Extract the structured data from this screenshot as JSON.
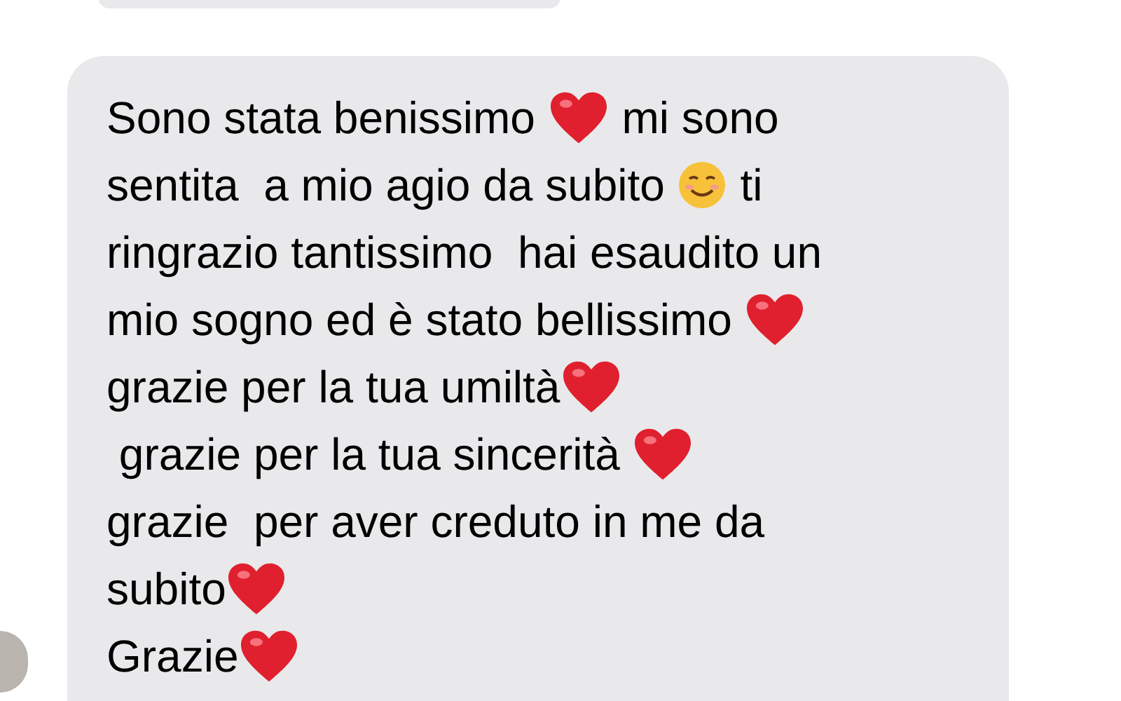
{
  "message": {
    "lines": [
      [
        {
          "kind": "text",
          "text": "Sono stata benissimo "
        },
        {
          "kind": "heart"
        },
        {
          "kind": "text",
          "text": " mi sono"
        }
      ],
      [
        {
          "kind": "text",
          "text": "sentita  a mio agio da subito "
        },
        {
          "kind": "smile"
        },
        {
          "kind": "text",
          "text": " ti"
        }
      ],
      [
        {
          "kind": "text",
          "text": "ringrazio tantissimo  hai esaudito un"
        }
      ],
      [
        {
          "kind": "text",
          "text": "mio sogno ed è stato bellissimo "
        },
        {
          "kind": "heart"
        }
      ],
      [
        {
          "kind": "text",
          "text": "grazie per la tua umiltà"
        },
        {
          "kind": "heart"
        }
      ],
      [
        {
          "kind": "text",
          "text": " grazie per la tua sincerità "
        },
        {
          "kind": "heart"
        }
      ],
      [
        {
          "kind": "text",
          "text": "grazie  per aver creduto in me da"
        }
      ],
      [
        {
          "kind": "text",
          "text": "subito"
        },
        {
          "kind": "heart"
        }
      ],
      [
        {
          "kind": "text",
          "text": "Grazie"
        },
        {
          "kind": "heart"
        }
      ]
    ]
  }
}
